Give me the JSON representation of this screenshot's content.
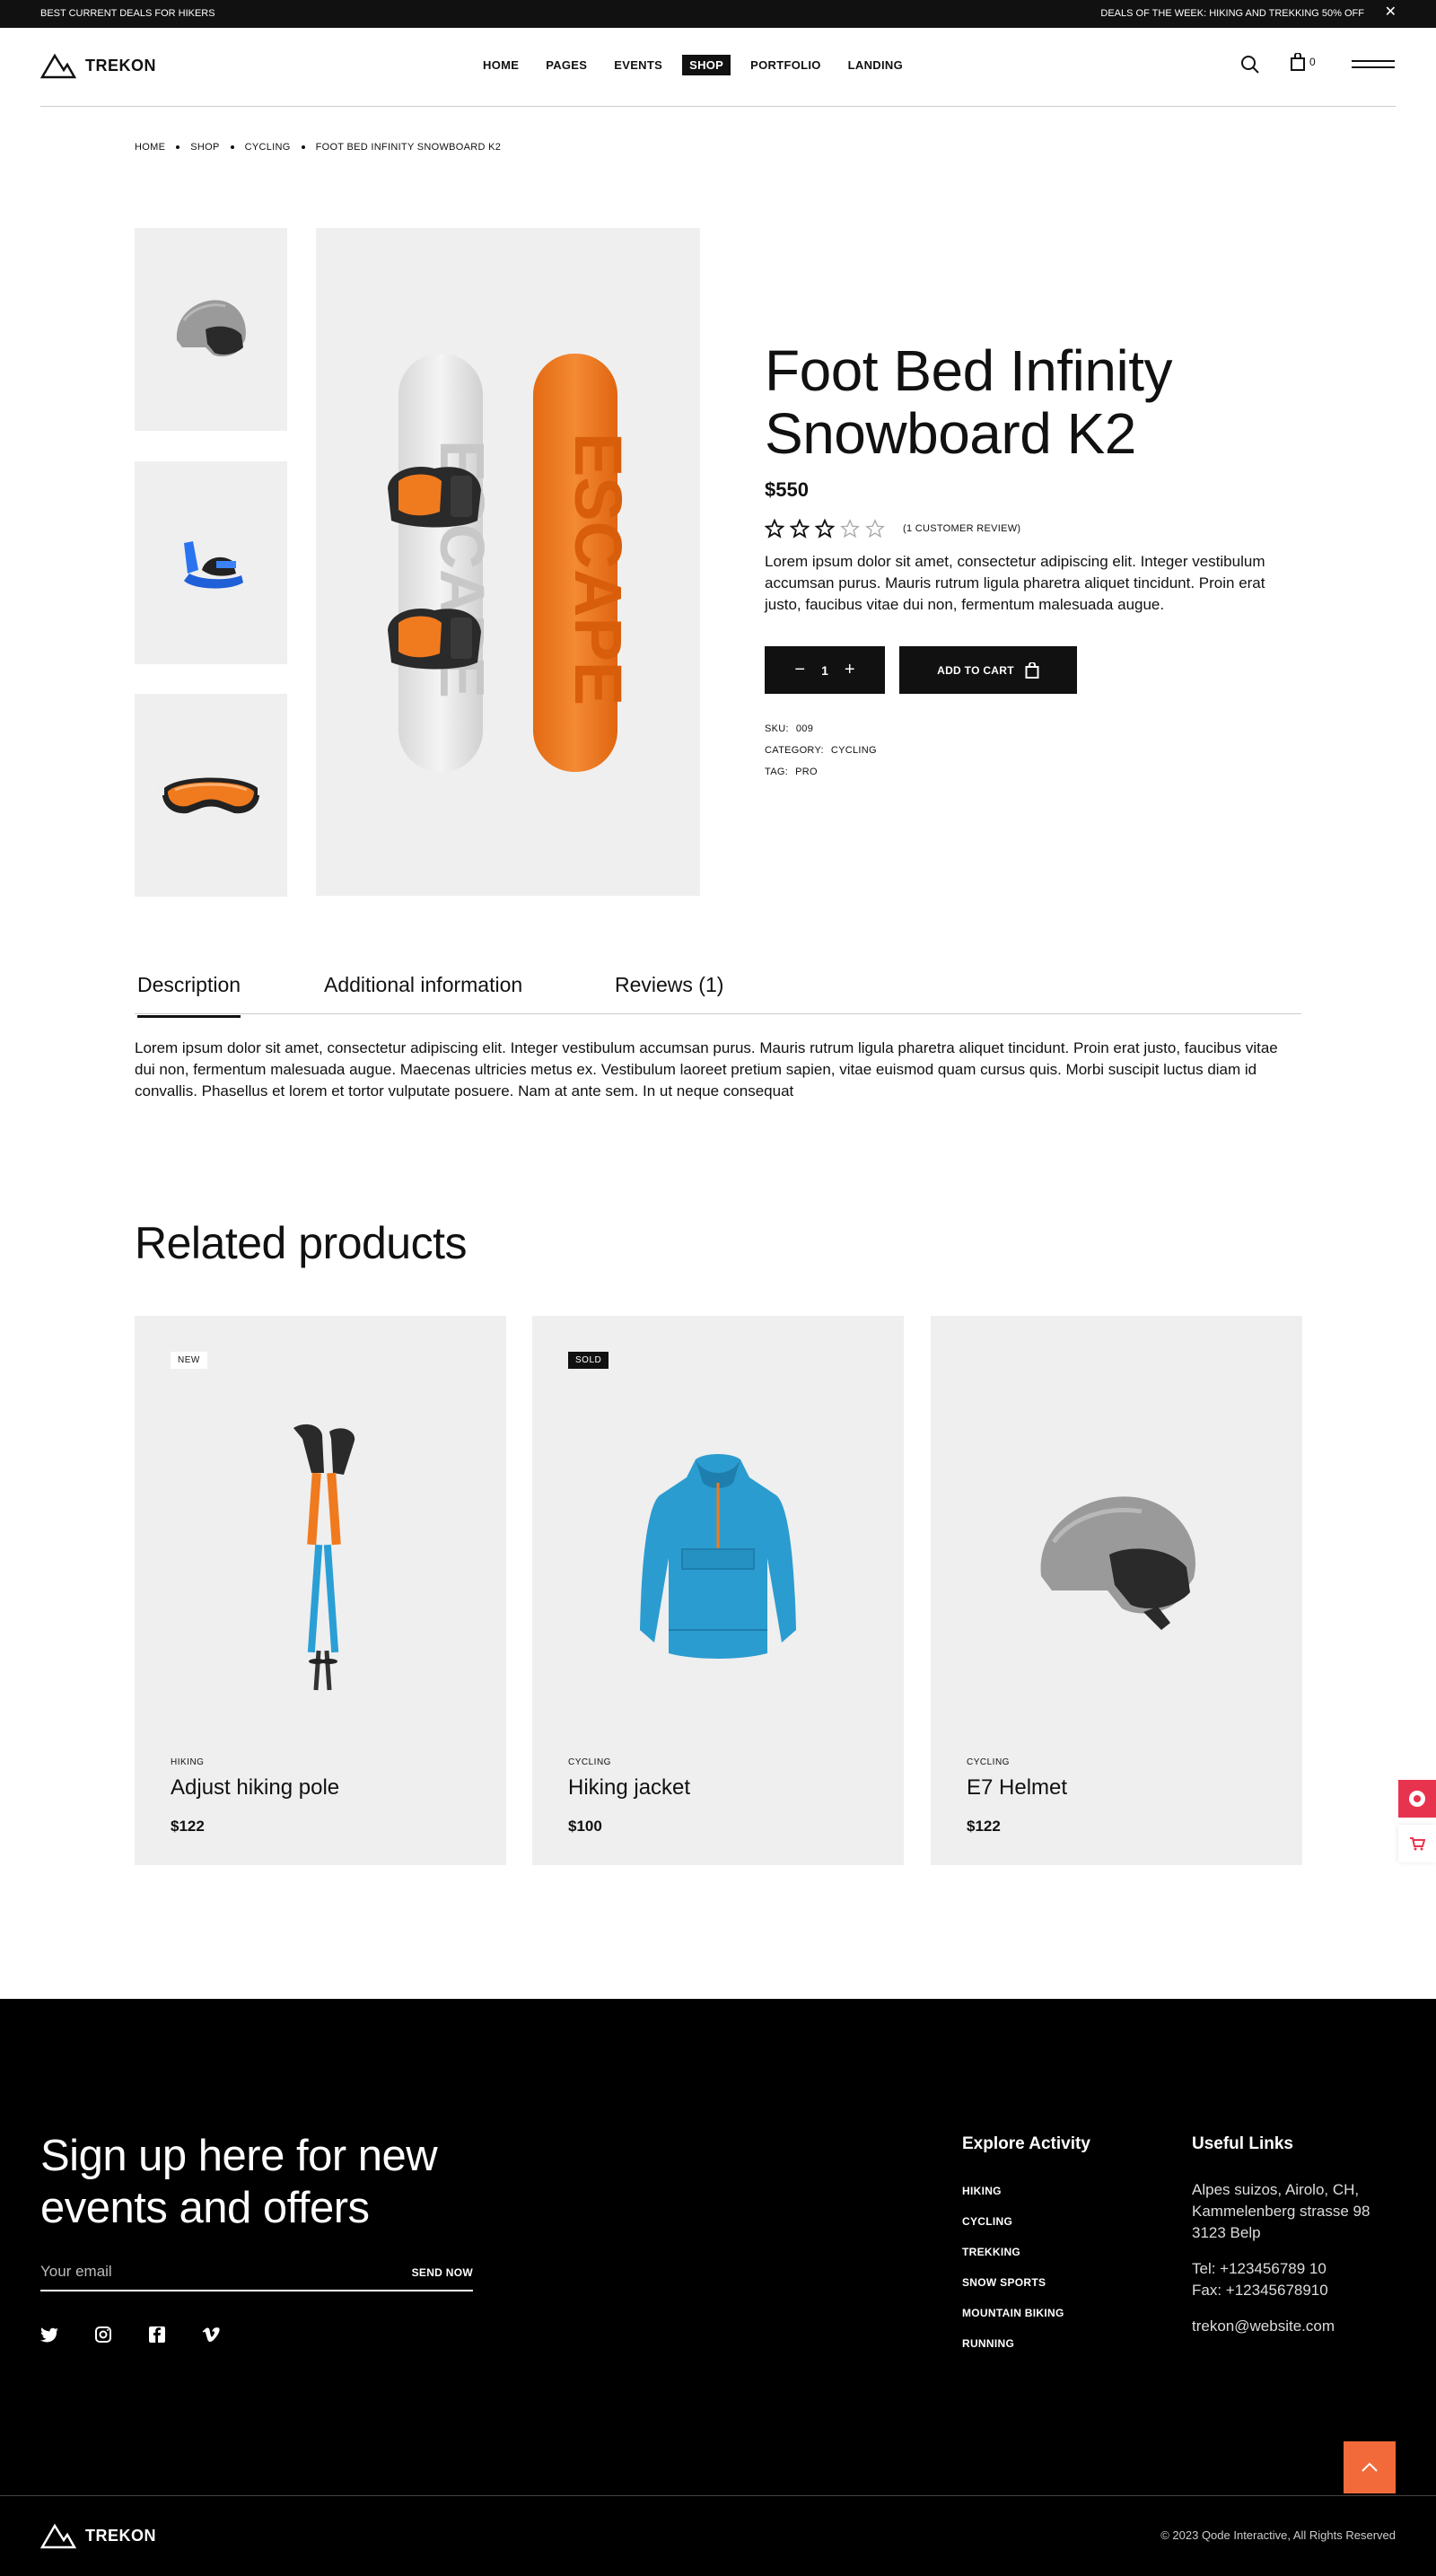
{
  "topbar": {
    "left_text": "BEST CURRENT DEALS FOR HIKERS",
    "right_text": "DEALS OF THE WEEK: HIKING AND TREKKING 50% OFF",
    "close_icon": "close-icon"
  },
  "header": {
    "logo_text": "TREKON",
    "nav": [
      "HOME",
      "PAGES",
      "EVENTS",
      "SHOP",
      "PORTFOLIO",
      "LANDING"
    ],
    "active_nav": "SHOP",
    "cart_count": "0"
  },
  "breadcrumb": [
    "HOME",
    "SHOP",
    "CYCLING",
    "FOOT BED INFINITY SNOWBOARD K2"
  ],
  "gallery": {
    "thumbs": [
      "helmet",
      "binding",
      "goggles"
    ],
    "main": "snowboard-pair",
    "board_text": "ESCAPE"
  },
  "product": {
    "title": "Foot Bed Infinity Snowboard K2",
    "price": "$550",
    "rating": 3,
    "rating_max": 5,
    "review_label": "(1 CUSTOMER REVIEW)",
    "description": "Lorem ipsum dolor sit amet, consectetur adipiscing elit. Integer vestibulum accumsan purus. Mauris rutrum ligula pharetra aliquet tincidunt. Proin erat justo, faucibus vitae dui non, fermentum malesuada augue.",
    "quantity": "1",
    "qty_minus": "−",
    "qty_plus": "+",
    "add_to_cart": "ADD TO CART",
    "sku_label": "SKU:",
    "sku": "009",
    "category_label": "CATEGORY:",
    "category": "CYCLING",
    "tag_label": "TAG:",
    "tag": "PRO"
  },
  "tabs": {
    "items": [
      "Description",
      "Additional information",
      "Reviews (1)"
    ],
    "active": "Description",
    "content": "Lorem ipsum dolor sit amet, consectetur adipiscing elit. Integer vestibulum accumsan purus. Mauris rutrum ligula pharetra aliquet tincidunt. Proin erat justo, faucibus vitae dui non, fermentum malesuada augue. Maecenas ultricies metus ex. Vestibulum laoreet pretium sapien, vitae euismod quam cursus quis. Morbi suscipit luctus diam id convallis. Phasellus et lorem et tortor vulputate posuere. Nam at ante sem. In ut neque consequat"
  },
  "related": {
    "title": "Related products",
    "products": [
      {
        "badge": "NEW",
        "category": "HIKING",
        "name": "Adjust hiking pole",
        "price": "$122",
        "image": "hiking-pole"
      },
      {
        "badge": "SOLD",
        "category": "CYCLING",
        "name": "Hiking jacket",
        "price": "$100",
        "image": "jacket"
      },
      {
        "badge": "",
        "category": "CYCLING",
        "name": "E7 Helmet",
        "price": "$122",
        "image": "helmet"
      }
    ]
  },
  "footer": {
    "signup_title": "Sign up here for new events and offers",
    "email_placeholder": "Your email",
    "send_label": "SEND NOW",
    "socials": [
      "twitter-icon",
      "instagram-icon",
      "facebook-icon",
      "vimeo-icon"
    ],
    "explore_title": "Explore Activity",
    "explore_items": [
      "HIKING",
      "CYCLING",
      "TREKKING",
      "SNOW SPORTS",
      "MOUNTAIN BIKING",
      "RUNNING"
    ],
    "useful_title": "Useful Links",
    "address": "Alpes suizos, Airolo, CH, Kammelenberg strasse 98 3123 Belp",
    "tel": "Tel: +123456789 10",
    "fax": "Fax: +12345678910",
    "email": "trekon@website.com",
    "logo_text": "TREKON",
    "copyright": "© 2023 Qode Interactive, All Rights Reserved"
  },
  "colors": {
    "accent": "#f26a3a",
    "dark": "#111111",
    "light_bg": "#efefef",
    "board_orange": "#f07a1e",
    "side_widget": "#e8334e"
  }
}
